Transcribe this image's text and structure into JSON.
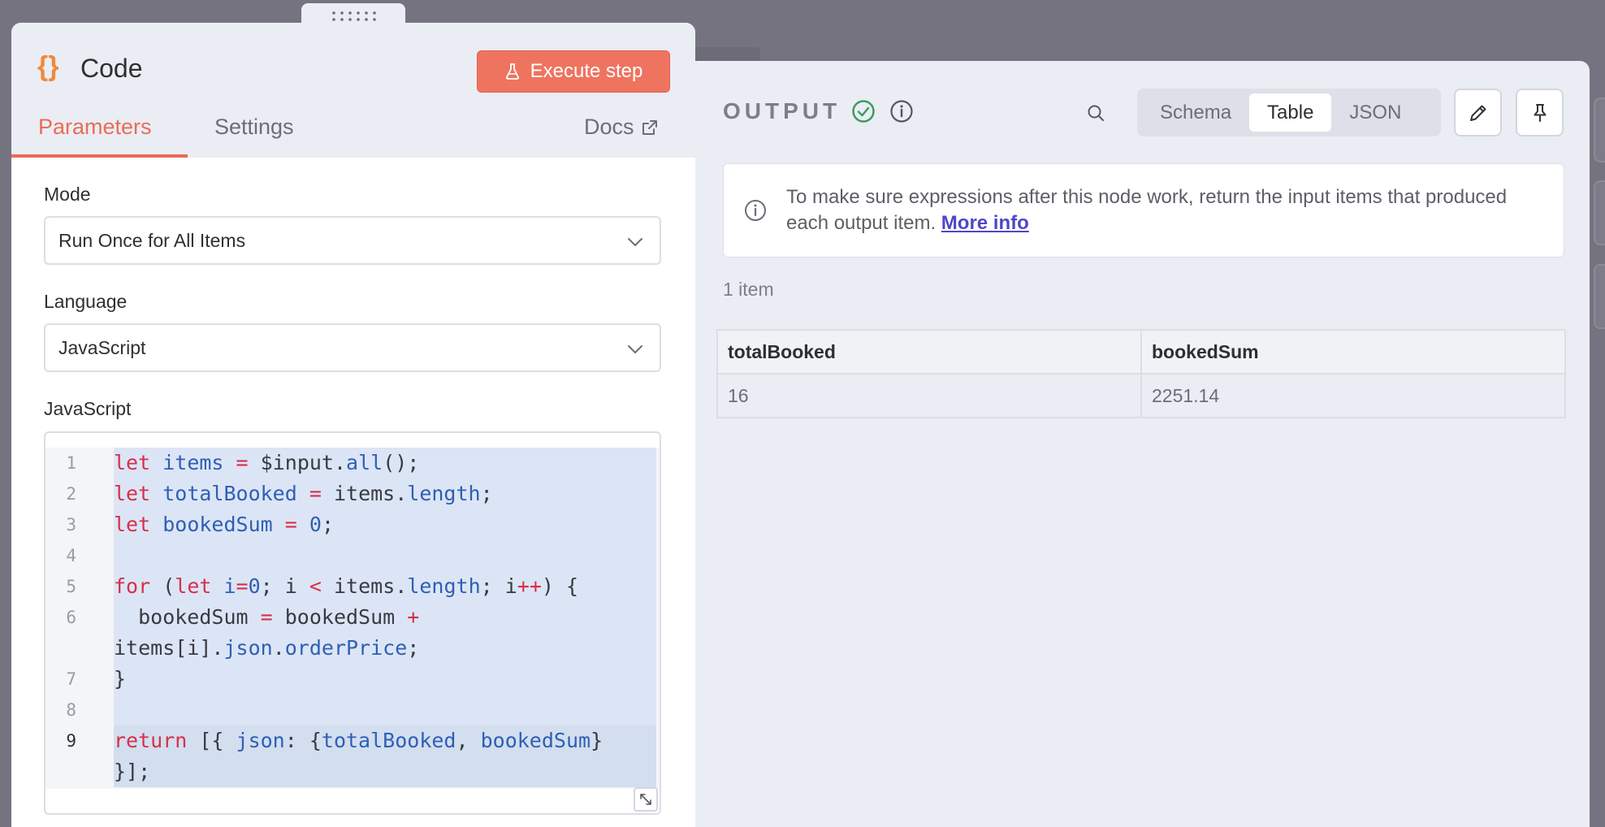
{
  "node": {
    "icon": "code-braces-icon",
    "title": "Code",
    "execute_label": "Execute step",
    "tabs": [
      {
        "label": "Parameters",
        "active": true
      },
      {
        "label": "Settings",
        "active": false
      }
    ],
    "docs_label": "Docs"
  },
  "params": {
    "mode_label": "Mode",
    "mode_value": "Run Once for All Items",
    "language_label": "Language",
    "language_value": "JavaScript",
    "code_label": "JavaScript",
    "code_lines": [
      {
        "num": "1",
        "text": "let items = $input.all();"
      },
      {
        "num": "2",
        "text": "let totalBooked = items.length;"
      },
      {
        "num": "3",
        "text": "let bookedSum = 0;"
      },
      {
        "num": "4",
        "text": ""
      },
      {
        "num": "5",
        "text": "for (let i=0; i < items.length; i++) {"
      },
      {
        "num": "6",
        "text": "  bookedSum = bookedSum +\nitems[i].json.orderPrice;"
      },
      {
        "num": "7",
        "text": "}"
      },
      {
        "num": "8",
        "text": ""
      },
      {
        "num": "9",
        "text": "return [{ json: {totalBooked, bookedSum}\n}];"
      }
    ]
  },
  "output": {
    "title": "OUTPUT",
    "views": [
      {
        "label": "Schema",
        "active": false
      },
      {
        "label": "Table",
        "active": true
      },
      {
        "label": "JSON",
        "active": false
      }
    ],
    "notice_text": "To make sure expressions after this node work, return the input items that produced each output item.",
    "notice_link": "More info",
    "item_count": "1 item",
    "table": {
      "headers": [
        "totalBooked",
        "bookedSum"
      ],
      "rows": [
        [
          "16",
          "2251.14"
        ]
      ]
    }
  },
  "colors": {
    "accent": "#ea6c56",
    "execute_button": "#ee7460",
    "success": "#3a9d5d",
    "link": "#5146c7"
  }
}
